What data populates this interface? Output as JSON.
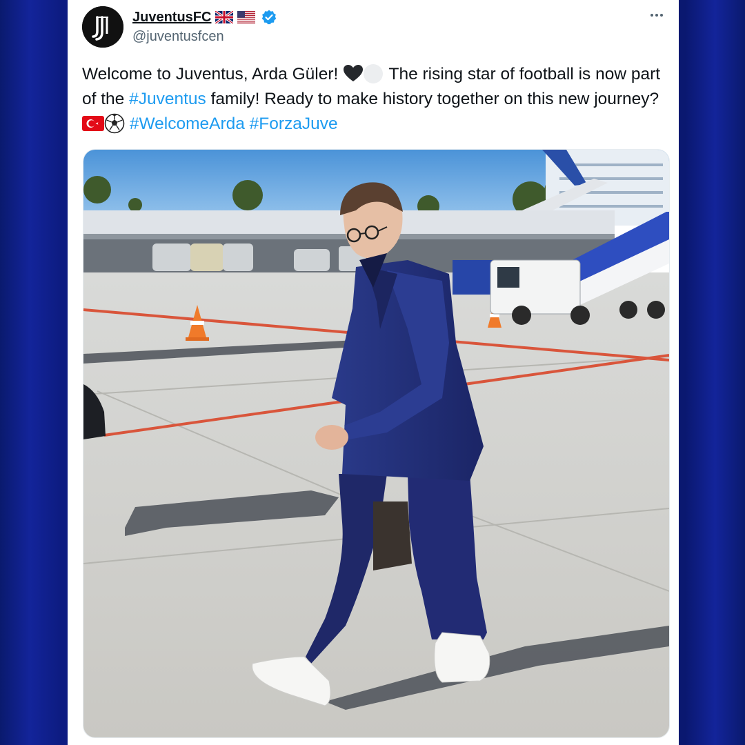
{
  "tweet": {
    "author": {
      "display_name": "JuventusFC",
      "handle": "@juventusfcen",
      "verified": true,
      "flags": [
        "united-kingdom-flag",
        "united-states-flag"
      ],
      "avatar_icon": "juventus-j-logo-icon"
    },
    "text": {
      "part1": "Welcome to Juventus, Arda Güler! ",
      "part2": " The rising star of football is now part of the ",
      "hashtag_juventus": "#Juventus",
      "part3": " family! Ready to make history together on this new journey? ",
      "hashtag_welcome": "#WelcomeArda",
      "space": " ",
      "hashtag_forza": "#ForzaJuve"
    },
    "emojis": [
      "black-heart-icon",
      "white-circle-icon",
      "turkey-flag-icon",
      "soccer-ball-icon"
    ],
    "menu_icon": "more-options-icon"
  },
  "colors": {
    "hashtag": "#1d9bf0",
    "verified": "#1d9bf0",
    "background": "#0d1c82"
  }
}
